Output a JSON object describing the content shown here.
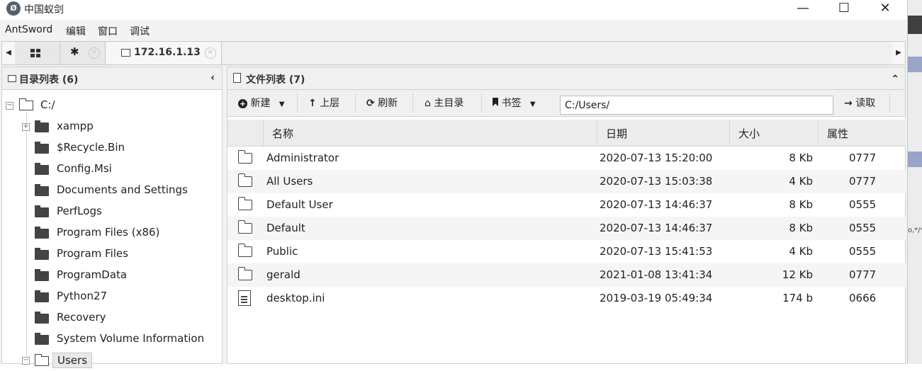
{
  "window": {
    "title": "中国蚁剑",
    "minimize": "—",
    "maximize": "☐",
    "close": "✕"
  },
  "menu": [
    "AntSword",
    "编辑",
    "窗口",
    "调试"
  ],
  "tabs": {
    "left_arrow": "◀",
    "right_arrow": "▶",
    "active_tab": "172.16.1.13",
    "close_glyph": "✕"
  },
  "dir_panel": {
    "title": "目录列表 (6)",
    "collapse_glyph": "‹",
    "root": "C:/",
    "items": [
      {
        "label": "xampp",
        "expandable": true
      },
      {
        "label": "$Recycle.Bin",
        "expandable": false
      },
      {
        "label": "Config.Msi",
        "expandable": false
      },
      {
        "label": "Documents and Settings",
        "expandable": false
      },
      {
        "label": "PerfLogs",
        "expandable": false
      },
      {
        "label": "Program Files (x86)",
        "expandable": false
      },
      {
        "label": "Program Files",
        "expandable": false
      },
      {
        "label": "ProgramData",
        "expandable": false
      },
      {
        "label": "Python27",
        "expandable": false
      },
      {
        "label": "Recovery",
        "expandable": false
      },
      {
        "label": "System Volume Information",
        "expandable": false
      },
      {
        "label": "Users",
        "expandable": true,
        "selected": true
      }
    ]
  },
  "file_panel": {
    "title": "文件列表 (7)",
    "collapse_glyph": "⌃",
    "toolbar": {
      "new_label": "新建",
      "up_label": "上层",
      "refresh_label": "刷新",
      "home_label": "主目录",
      "bookmark_label": "书签",
      "path_value": "C:/Users/",
      "read_label": "读取"
    },
    "columns": {
      "name": "名称",
      "date": "日期",
      "size": "大小",
      "attr": "属性"
    },
    "rows": [
      {
        "type": "folder",
        "name": "Administrator",
        "date": "2020-07-13 15:20:00",
        "size": "8 Kb",
        "attr": "0777"
      },
      {
        "type": "folder",
        "name": "All Users",
        "date": "2020-07-13 15:03:38",
        "size": "4 Kb",
        "attr": "0777"
      },
      {
        "type": "folder",
        "name": "Default User",
        "date": "2020-07-13 14:46:37",
        "size": "8 Kb",
        "attr": "0555"
      },
      {
        "type": "folder",
        "name": "Default",
        "date": "2020-07-13 14:46:37",
        "size": "8 Kb",
        "attr": "0555"
      },
      {
        "type": "folder",
        "name": "Public",
        "date": "2020-07-13 15:41:53",
        "size": "4 Kb",
        "attr": "0555"
      },
      {
        "type": "folder",
        "name": "gerald",
        "date": "2021-01-08 13:41:34",
        "size": "12 Kb",
        "attr": "0777"
      },
      {
        "type": "file",
        "name": "desktop.ini",
        "date": "2019-03-19 05:49:34",
        "size": "174 b",
        "attr": "0666"
      }
    ]
  },
  "background_fragment": "o,*/*"
}
